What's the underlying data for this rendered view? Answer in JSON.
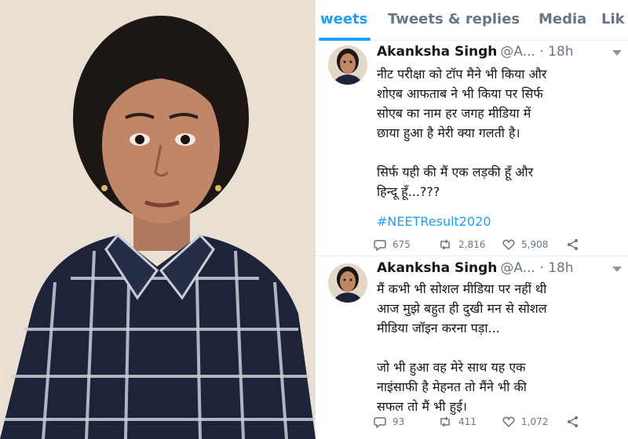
{
  "tabs": [
    {
      "label": "weets",
      "active": true
    },
    {
      "label": "Tweets & replies",
      "active": false
    },
    {
      "label": "Media",
      "active": false
    },
    {
      "label": "Lik",
      "active": false
    }
  ],
  "tweets": [
    {
      "name": "Akanksha Singh",
      "handle": "@A...",
      "time": "· 18h",
      "body": "नीट परीक्षा को टॉप मैने भी किया और\nशोएब आफताब ने भी किया पर सिर्फ\nसोएब का नाम हर जगह मीडिया में\nछाया हुआ है मेरी क्या गलती है।\n\nसिर्फ यही की मैं एक लड़की हूँ और\nहिन्दू हूँ...???",
      "hashtag": "#NEETResult2020",
      "replies": "675",
      "retweets": "2,816",
      "likes": "5,908"
    },
    {
      "name": "Akanksha Singh",
      "handle": "@A...",
      "time": "· 18h",
      "body": "मैं कभी भी सोशल मीडिया पर नहीं थी\nआज मुझे बहुत ही दुखी मन से सोशल\nमीडिया जॉइन करना पड़ा...\n\nजो भी हुआ वह मेरे साथ यह एक\nनाइंसाफी है मेहनत तो मैंने भी की\nसफल तो मैं भी हुई।",
      "replies": "93",
      "retweets": "411",
      "likes": "1,072"
    }
  ],
  "colors": {
    "accent": "#1da1f2",
    "text": "#14171a",
    "muted": "#657786"
  },
  "icons": [
    "reply-icon",
    "retweet-icon",
    "like-icon",
    "share-icon",
    "caret-down-icon"
  ]
}
